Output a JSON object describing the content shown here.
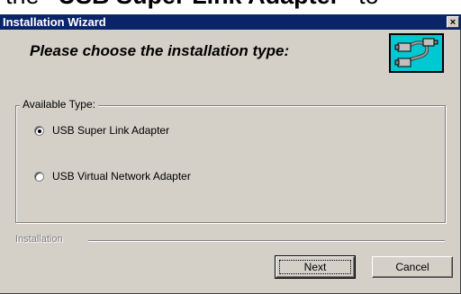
{
  "document": {
    "text_before": "the ",
    "text_bold": "“USB Super Link Adapter”",
    "text_after": " to"
  },
  "window": {
    "title": "Installation  Wizard",
    "close_glyph": "×"
  },
  "header": {
    "prompt": "Please choose the installation type:",
    "icon": "usb-cable-icon",
    "icon_bg": "#00c8d2"
  },
  "type_group": {
    "legend": "Available Type:",
    "options": [
      {
        "label": "USB Super Link Adapter",
        "selected": true
      },
      {
        "label": "USB Virtual Network Adapter",
        "selected": false
      }
    ]
  },
  "installation_label": "Installation",
  "buttons": {
    "next": "Next",
    "cancel": "Cancel"
  },
  "colors": {
    "titlebar": "#0a246a",
    "face": "#d4d0c8"
  }
}
